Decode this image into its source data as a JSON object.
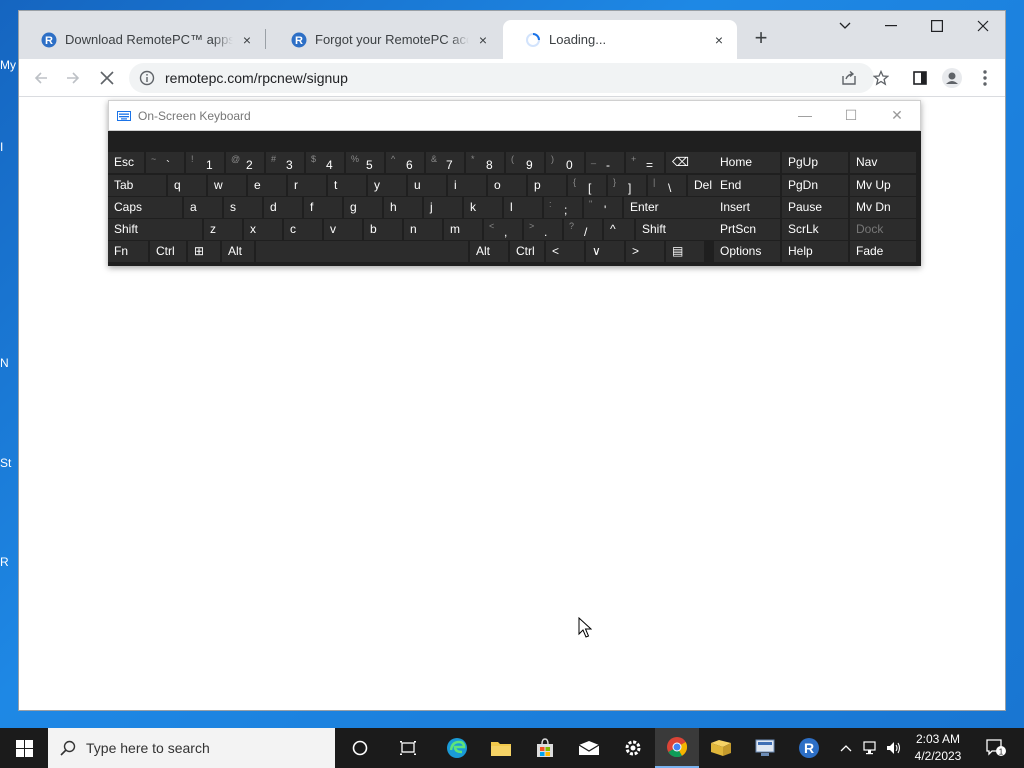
{
  "desktop": {
    "fragments": [
      "My",
      "I",
      "N",
      "St",
      "R"
    ]
  },
  "browser": {
    "tabs": [
      {
        "title": "Download RemotePC™ apps for",
        "favicon": "remotepc-icon",
        "close": "×"
      },
      {
        "title": "Forgot your RemotePC account p",
        "favicon": "remotepc-icon",
        "close": "×"
      },
      {
        "title": "Loading...",
        "favicon": "loading-spinner-icon",
        "close": "×"
      }
    ],
    "new_tab": "+",
    "address": "remotepc.com/rpcnew/signup"
  },
  "osk": {
    "title": "On-Screen Keyboard",
    "rows": [
      [
        {
          "label": "Esc"
        },
        {
          "sub": "~",
          "main": "`"
        },
        {
          "sub": "!",
          "main": "1"
        },
        {
          "sub": "@",
          "main": "2"
        },
        {
          "sub": "#",
          "main": "3"
        },
        {
          "sub": "$",
          "main": "4"
        },
        {
          "sub": "%",
          "main": "5"
        },
        {
          "sub": "^",
          "main": "6"
        },
        {
          "sub": "&",
          "main": "7"
        },
        {
          "sub": "*",
          "main": "8"
        },
        {
          "sub": "(",
          "main": "9"
        },
        {
          "sub": ")",
          "main": "0"
        },
        {
          "sub": "_",
          "main": "-"
        },
        {
          "sub": "+",
          "main": "="
        },
        {
          "label": "⌫"
        },
        {
          "label": "Home"
        },
        {
          "label": "PgUp"
        },
        {
          "label": "Nav"
        }
      ],
      [
        {
          "label": "Tab"
        },
        {
          "label": "q"
        },
        {
          "label": "w"
        },
        {
          "label": "e"
        },
        {
          "label": "r"
        },
        {
          "label": "t"
        },
        {
          "label": "y"
        },
        {
          "label": "u"
        },
        {
          "label": "i"
        },
        {
          "label": "o"
        },
        {
          "label": "p"
        },
        {
          "sub": "{",
          "main": "["
        },
        {
          "sub": "}",
          "main": "]"
        },
        {
          "sub": "|",
          "main": "\\"
        },
        {
          "label": "Del"
        },
        {
          "label": "End"
        },
        {
          "label": "PgDn"
        },
        {
          "label": "Mv Up"
        }
      ],
      [
        {
          "label": "Caps"
        },
        {
          "label": "a"
        },
        {
          "label": "s"
        },
        {
          "label": "d"
        },
        {
          "label": "f"
        },
        {
          "label": "g"
        },
        {
          "label": "h"
        },
        {
          "label": "j"
        },
        {
          "label": "k"
        },
        {
          "label": "l"
        },
        {
          "sub": ":",
          "main": ";"
        },
        {
          "sub": "\"",
          "main": "'"
        },
        {
          "label": "Enter"
        },
        {
          "label": "Insert"
        },
        {
          "label": "Pause"
        },
        {
          "label": "Mv Dn"
        }
      ],
      [
        {
          "label": "Shift"
        },
        {
          "label": "z"
        },
        {
          "label": "x"
        },
        {
          "label": "c"
        },
        {
          "label": "v"
        },
        {
          "label": "b"
        },
        {
          "label": "n"
        },
        {
          "label": "m"
        },
        {
          "sub": "<",
          "main": ","
        },
        {
          "sub": ">",
          "main": "."
        },
        {
          "sub": "?",
          "main": "/"
        },
        {
          "label": "^"
        },
        {
          "label": "Shift"
        },
        {
          "label": "PrtScn"
        },
        {
          "label": "ScrLk"
        },
        {
          "label": "Dock",
          "dim": true
        }
      ],
      [
        {
          "label": "Fn"
        },
        {
          "label": "Ctrl"
        },
        {
          "label": "⊞"
        },
        {
          "label": "Alt"
        },
        {
          "label": ""
        },
        {
          "label": "Alt"
        },
        {
          "label": "Ctrl"
        },
        {
          "label": "<"
        },
        {
          "label": "∨"
        },
        {
          "label": ">"
        },
        {
          "label": "▤"
        },
        {
          "label": "Options"
        },
        {
          "label": "Help"
        },
        {
          "label": "Fade"
        }
      ]
    ]
  },
  "taskbar": {
    "search_placeholder": "Type here to search",
    "time": "2:03 AM",
    "date": "4/2/2023",
    "notification_count": "1"
  }
}
